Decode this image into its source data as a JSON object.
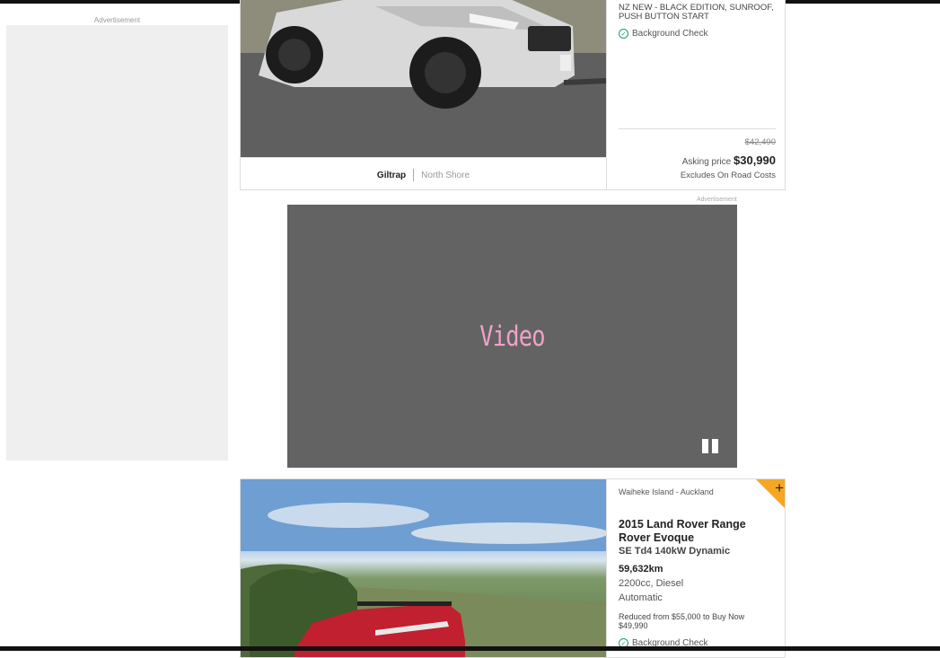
{
  "sidebar": {
    "ad_label": "Advertisement"
  },
  "listing1": {
    "description": "NZ NEW - BLACK EDITION, SUNROOF, PUSH BUTTON START",
    "background_check": "Background Check",
    "old_price": "$42,490",
    "asking_label": "Asking price",
    "asking_price": "$30,990",
    "road_costs": "Excludes On Road Costs",
    "dealer_brand": "Giltrap",
    "dealer_branch": "North Shore"
  },
  "video_ad": {
    "ad_label": "Advertisement",
    "label": "Video"
  },
  "listing2": {
    "location": "Waiheke Island - Auckland",
    "title": "2015 Land Rover Range Rover Evoque",
    "subtitle": "SE Td4 140kW Dynamic",
    "odometer": "59,632km",
    "engine": "2200cc, Diesel",
    "transmission": "Automatic",
    "reduced_text": "Reduced from $55,000 to Buy Now $49,990",
    "background_check": "Background Check",
    "corner_icon": "+"
  },
  "colors": {
    "accent_orange": "#f5a623",
    "check_green": "#17a267",
    "video_bg": "#636363",
    "video_text": "#f0a2c8"
  }
}
